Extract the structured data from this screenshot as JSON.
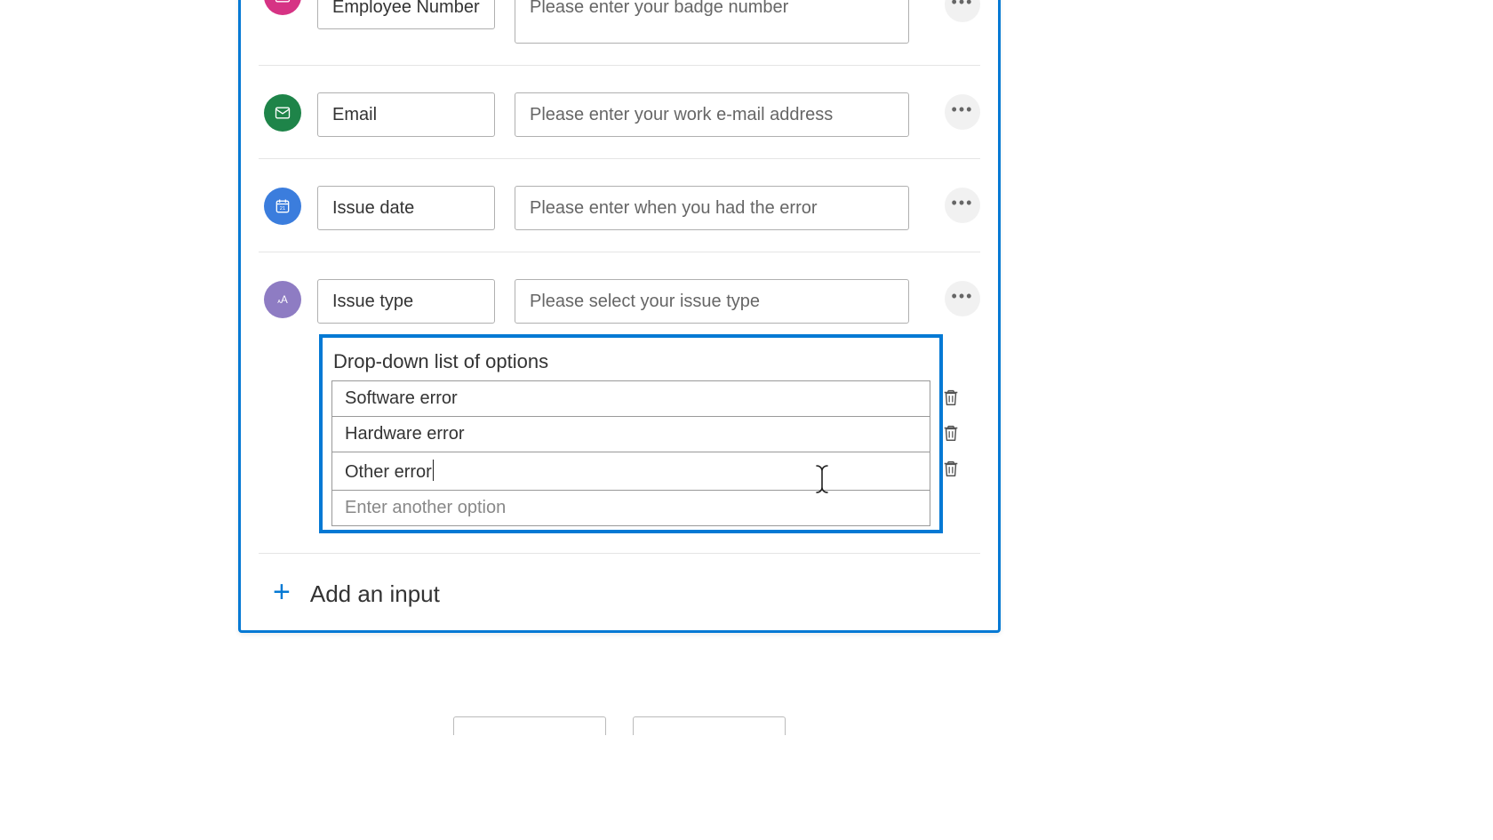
{
  "fields": [
    {
      "icon": "number",
      "icon_color": "pink",
      "name": "Employee Number",
      "prompt": "Please enter your badge number"
    },
    {
      "icon": "email",
      "icon_color": "green",
      "name": "Email",
      "prompt": "Please enter your work e-mail address"
    },
    {
      "icon": "calendar",
      "icon_color": "blue",
      "name": "Issue date",
      "prompt": "Please enter when you had the error"
    },
    {
      "icon": "text",
      "icon_color": "purple",
      "name": "Issue type",
      "prompt": "Please select your issue type"
    }
  ],
  "dropdown": {
    "title": "Drop-down list of options",
    "options": [
      "Software error",
      "Hardware error",
      "Other error"
    ],
    "new_option_placeholder": "Enter another option",
    "editing_index": 2
  },
  "add_input_label": "Add an input"
}
